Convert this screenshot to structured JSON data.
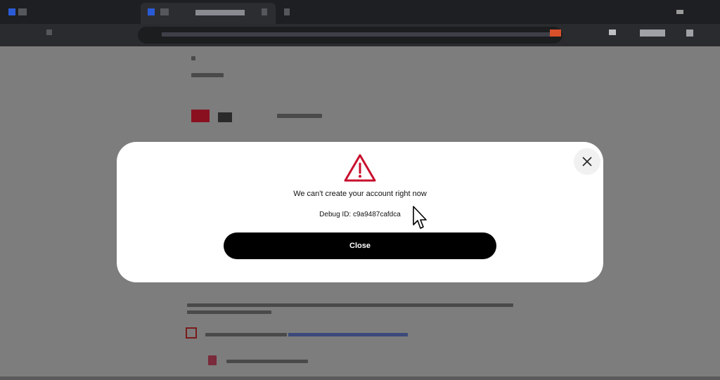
{
  "dialog": {
    "title": "We can't create your account right now",
    "debug_text": "Debug ID: c9a9487cafdca",
    "close_button_label": "Close",
    "icon": "warning-triangle-icon",
    "icon_color": "#c8102e",
    "dismiss_icon": "close-icon"
  },
  "colors": {
    "overlay": "#7d7d7d",
    "dialog_bg": "#ffffff",
    "button_bg": "#000000",
    "button_text": "#ffffff"
  }
}
